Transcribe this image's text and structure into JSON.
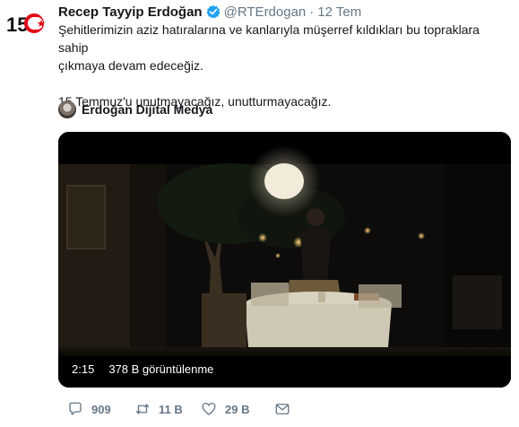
{
  "tweet": {
    "author_name": "Recep Tayyip Erdoğan",
    "handle": "@RTErdogan",
    "separator": "·",
    "time": "12 Tem",
    "text_line1": "Şehitlerimizin aziz hatıralarına ve kanlarıyla müşerref kıldıkları bu topraklara sahip",
    "text_line2": "çıkmaya devam edeceğiz.",
    "text_line3": "15 Temmuz'u unutmayacağız, unutturmayacağız.",
    "avatar_logo_text": "15"
  },
  "channel": {
    "name": "Erdoğan Dijital Medya"
  },
  "video": {
    "duration": "2:15",
    "views": "378 B görüntülenme"
  },
  "actions": {
    "reply_count": "909",
    "retweet_count": "11 B",
    "like_count": "29 B"
  },
  "colors": {
    "text": "#14171a",
    "secondary": "#657786",
    "verified": "#1da1f2",
    "logo_red": "#e30a17"
  },
  "icons": {
    "verified": "verified-badge-icon",
    "reply": "reply-icon",
    "retweet": "retweet-icon",
    "like": "heart-icon",
    "dm": "envelope-icon"
  }
}
